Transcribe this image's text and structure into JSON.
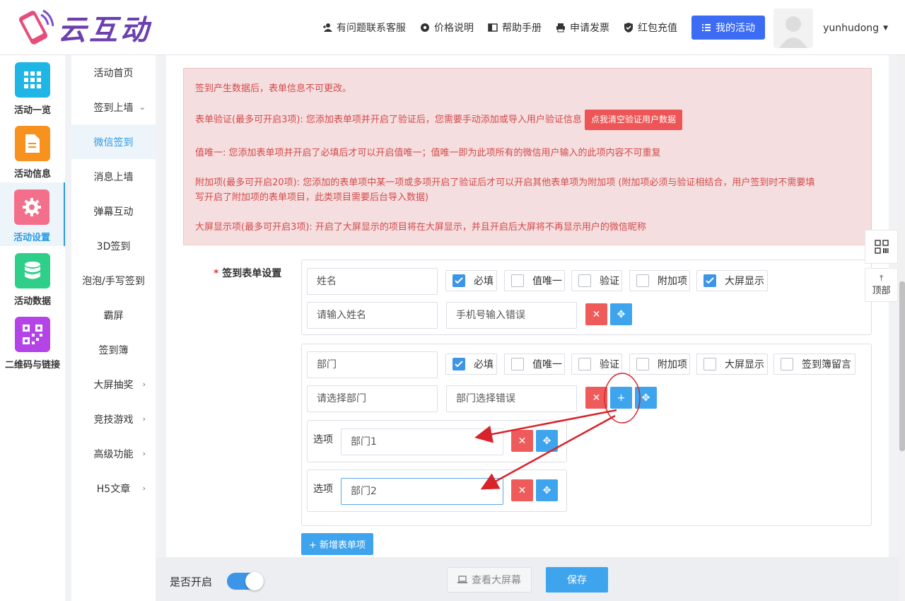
{
  "brand": {
    "name": "云互动"
  },
  "topnav": {
    "support": "有问题联系客服",
    "pricing": "价格说明",
    "manual": "帮助手册",
    "invoice": "申请发票",
    "recharge": "红包充值",
    "my_activity": "我的活动"
  },
  "user": {
    "name": "yunhudong"
  },
  "rail": [
    {
      "label": "活动一览",
      "icon": "grid-icon",
      "color": "#1fb6e6"
    },
    {
      "label": "活动信息",
      "icon": "document-icon",
      "color": "#f7921e"
    },
    {
      "label": "活动设置",
      "icon": "gear-icon",
      "color": "#f36f8c"
    },
    {
      "label": "活动数据",
      "icon": "database-icon",
      "color": "#2fcf8a"
    },
    {
      "label": "二维码与链接",
      "icon": "qrcode-icon",
      "color": "#b444e8"
    }
  ],
  "subnav": [
    {
      "label": "活动首页"
    },
    {
      "label": "签到上墙"
    },
    {
      "label": "微信签到"
    },
    {
      "label": "消息上墙"
    },
    {
      "label": "弹幕互动"
    },
    {
      "label": "3D签到"
    },
    {
      "label": "泡泡/手写签到"
    },
    {
      "label": "霸屏"
    },
    {
      "label": "签到簿"
    },
    {
      "label": "大屏抽奖"
    },
    {
      "label": "竞技游戏"
    },
    {
      "label": "高级功能"
    },
    {
      "label": "H5文章"
    }
  ],
  "notice": {
    "line1": "签到产生数据后，表单信息不可更改。",
    "line2": "表单验证(最多可开启3项): 您添加表单项并开启了验证后，您需要手动添加或导入用户验证信息",
    "clear_button": "点我清空验证用户数据",
    "line3": "值唯一: 您添加表单项并开启了必填后才可以开启值唯一；值唯一即为此项所有的微信用户输入的此项内容不可重复",
    "line4a": "附加项(最多可开启20项): 您添加的表单项中某一项或多项开启了验证后才可以开启其他表单项为附加项 (附加项必须与验证相结合，用户签到时不需要填",
    "line4b": "写开启了附加项的表单项目，此类项目需要后台导入数据)",
    "line5": "大屏显示项(最多可开启3项): 开启了大屏显示的项目将在大屏显示，并且开启后大屏将不再显示用户的微信昵称"
  },
  "form": {
    "label_star": "*",
    "label": "签到表单设置",
    "checks": {
      "required": "必填",
      "unique": "值唯一",
      "verify": "验证",
      "extra": "附加项",
      "screen": "大屏显示",
      "guestbook": "签到簿留言"
    },
    "item1": {
      "name": "姓名",
      "placeholder": "请输入姓名",
      "error": "手机号输入错误",
      "required": true,
      "unique": false,
      "verify": false,
      "extra": false,
      "screen": true
    },
    "item2": {
      "name": "部门",
      "placeholder": "请选择部门",
      "error": "部门选择错误",
      "required": true,
      "unique": false,
      "verify": false,
      "extra": false,
      "screen": false,
      "guestbook": false
    },
    "option_label": "选项",
    "options": [
      "部门1",
      "部门2"
    ],
    "add_item": "+ 新增表单项"
  },
  "footer": {
    "enable_label": "是否开启",
    "enabled": true,
    "view_screen": "查看大屏幕",
    "save": "保存"
  },
  "float": {
    "qrcode_icon": "qrcode-icon",
    "top": "顶部"
  }
}
